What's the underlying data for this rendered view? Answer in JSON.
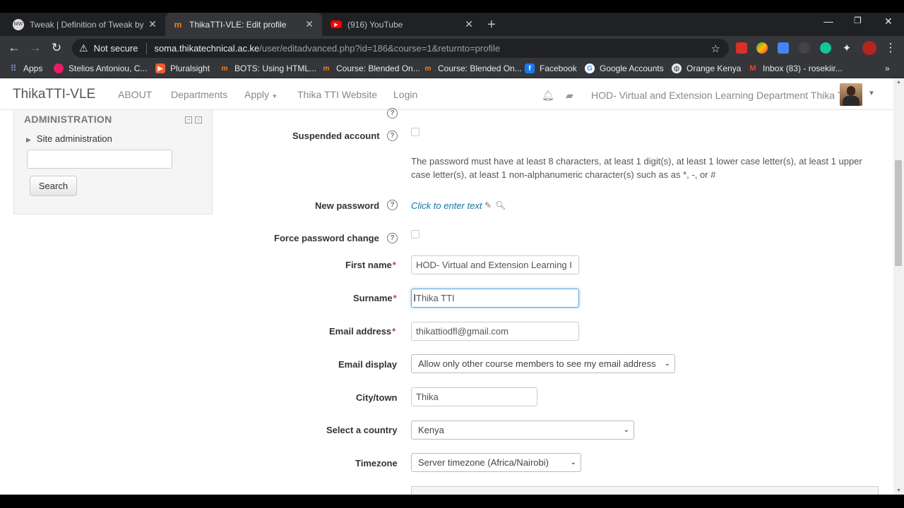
{
  "browser": {
    "tabs": [
      {
        "title": "Tweak | Definition of Tweak by M",
        "favicon": "merriam-webster-icon",
        "active": false
      },
      {
        "title": "ThikaTTI-VLE: Edit profile",
        "favicon": "moodle-icon",
        "active": true
      },
      {
        "title": "(916) YouTube",
        "favicon": "youtube-icon",
        "active": false
      }
    ],
    "security_label": "Not secure",
    "url_host": "soma.thikatechnical.ac.ke",
    "url_path": "/user/editadvanced.php?id=186&course=1&returnto=profile",
    "bookmarks": [
      "Apps",
      "Stelios Antoniou, C...",
      "Pluralsight",
      "BOTS: Using HTML...",
      "Course: Blended On...",
      "Course: Blended On...",
      "Facebook",
      "Google Accounts",
      "Orange Kenya",
      "Inbox (83) - rosekiir..."
    ]
  },
  "site": {
    "brand": "ThikaTTI-VLE",
    "nav": [
      "ABOUT",
      "Departments",
      "Apply",
      "Thika TTI Website",
      "Login"
    ],
    "user_name": "HOD- Virtual and Extension Learning Department Thika TTI"
  },
  "admin_block": {
    "title": "ADMINISTRATION",
    "item": "Site administration",
    "search_button": "Search"
  },
  "form": {
    "suspended_label": "Suspended account",
    "password_note": "The password must have at least 8 characters, at least 1 digit(s), at least 1 lower case letter(s), at least 1 upper case letter(s), at least 1 non-alphanumeric character(s) such as as *, -, or #",
    "new_password_label": "New password",
    "new_password_link": "Click to enter text",
    "force_change_label": "Force password change",
    "first_name_label": "First name",
    "first_name_value": "HOD- Virtual and Extension Learning  I",
    "surname_label": "Surname",
    "surname_value": "Thika TTI",
    "email_label": "Email address",
    "email_value": "thikattiodfl@gmail.com",
    "email_display_label": "Email display",
    "email_display_value": "Allow only other course members to see my email address",
    "city_label": "City/town",
    "city_value": "Thika",
    "country_label": "Select a country",
    "country_value": "Kenya",
    "timezone_label": "Timezone",
    "timezone_value": "Server timezone (Africa/Nairobi)",
    "required_mark": "*",
    "help_glyph": "?"
  }
}
